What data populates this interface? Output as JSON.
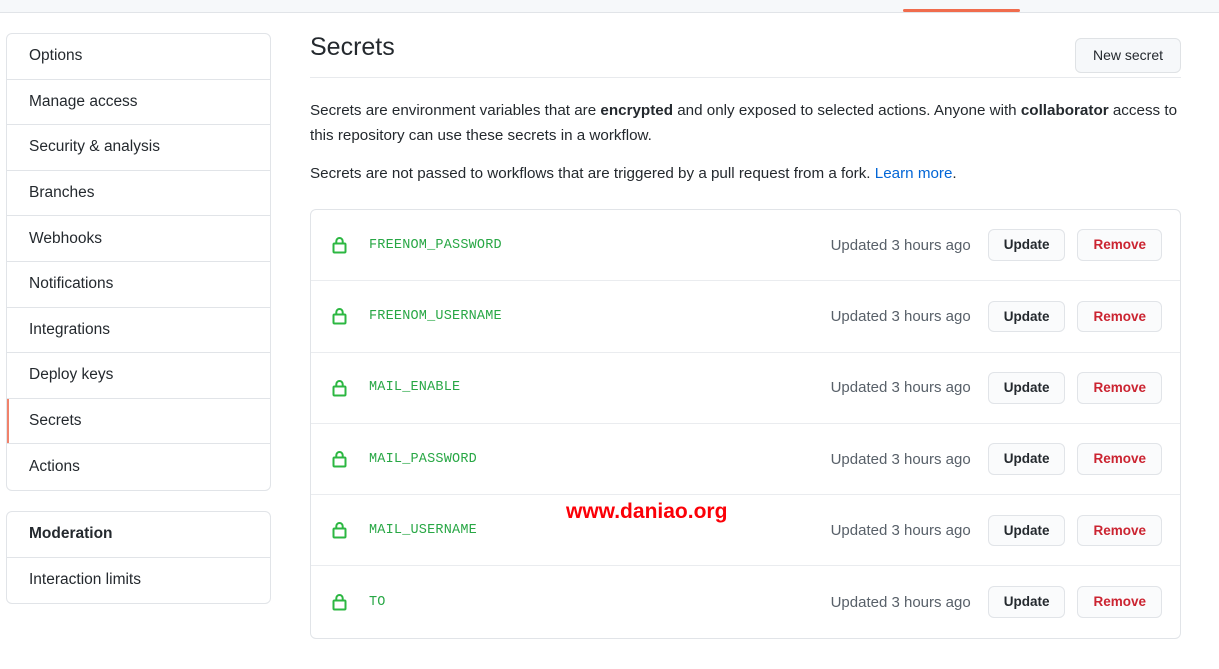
{
  "tabbar": {
    "accent_color": "#f06c4d"
  },
  "sidebar": {
    "groups": [
      {
        "items": [
          {
            "label": "Options",
            "selected": false
          },
          {
            "label": "Manage access",
            "selected": false
          },
          {
            "label": "Security & analysis",
            "selected": false
          },
          {
            "label": "Branches",
            "selected": false
          },
          {
            "label": "Webhooks",
            "selected": false
          },
          {
            "label": "Notifications",
            "selected": false
          },
          {
            "label": "Integrations",
            "selected": false
          },
          {
            "label": "Deploy keys",
            "selected": false
          },
          {
            "label": "Secrets",
            "selected": true
          },
          {
            "label": "Actions",
            "selected": false
          }
        ]
      },
      {
        "items": [
          {
            "label": "Moderation",
            "heading": true
          },
          {
            "label": "Interaction limits",
            "heading": false
          }
        ]
      }
    ]
  },
  "header": {
    "title": "Secrets",
    "new_secret_label": "New secret"
  },
  "intro": {
    "p1_a": "Secrets are environment variables that are ",
    "p1_bold1": "encrypted",
    "p1_b": " and only exposed to selected actions. Anyone with ",
    "p1_bold2": "collaborator",
    "p1_c": " access to this repository can use these secrets in a workflow.",
    "p2_a": "Secrets are not passed to workflows that are triggered by a pull request from a fork. ",
    "p2_link": "Learn more",
    "p2_b": "."
  },
  "secrets": {
    "update_label": "Update",
    "remove_label": "Remove",
    "icon": "lock-icon",
    "rows": [
      {
        "name": "FREENOM_PASSWORD",
        "updated": "Updated 3 hours ago"
      },
      {
        "name": "FREENOM_USERNAME",
        "updated": "Updated 3 hours ago"
      },
      {
        "name": "MAIL_ENABLE",
        "updated": "Updated 3 hours ago"
      },
      {
        "name": "MAIL_PASSWORD",
        "updated": "Updated 3 hours ago"
      },
      {
        "name": "MAIL_USERNAME",
        "updated": "Updated 3 hours ago"
      },
      {
        "name": "TO",
        "updated": "Updated 3 hours ago"
      }
    ]
  },
  "watermark": {
    "text": "www.daniao.org",
    "color": "#fb0007"
  }
}
